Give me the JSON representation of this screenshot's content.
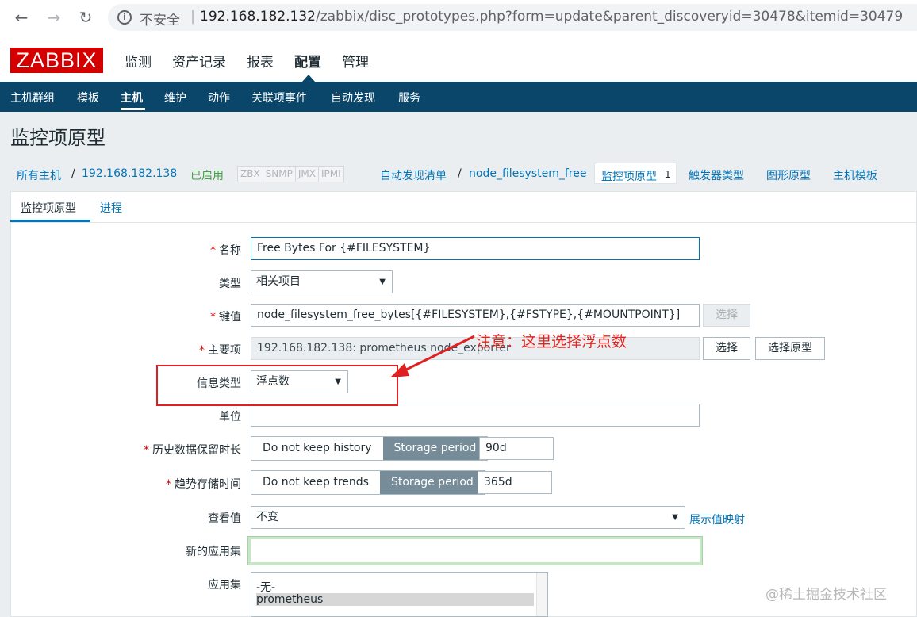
{
  "browser": {
    "insecure": "不安全",
    "url_host": "192.168.182.132",
    "url_path": "/zabbix/disc_prototypes.php?form=update&parent_discoveryid=30478&itemid=30479"
  },
  "logo": "ZABBIX",
  "top_menu": [
    "监测",
    "资产记录",
    "报表",
    "配置",
    "管理"
  ],
  "sub_menu": [
    "主机群组",
    "模板",
    "主机",
    "维护",
    "动作",
    "关联项事件",
    "自动发现",
    "服务"
  ],
  "page_title": "监控项原型",
  "breadcrumb": {
    "all_hosts": "所有主机",
    "host": "192.168.182.138",
    "status": "已启用",
    "availability": [
      "ZBX",
      "SNMP",
      "JMX",
      "IPMI"
    ],
    "discovery_list": "自动发现清单",
    "discovery_rule": "node_filesystem_free",
    "item_prototypes": "监控项原型",
    "item_prototypes_count": "1",
    "trigger_types": "触发器类型",
    "graph_prototypes": "图形原型",
    "host_templates": "主机模板"
  },
  "tabs": [
    "监控项原型",
    "进程"
  ],
  "form": {
    "name_label": "名称",
    "name_value": "Free Bytes For {#FILESYSTEM}",
    "type_label": "类型",
    "type_value": "相关项目",
    "key_label": "键值",
    "key_value": "node_filesystem_free_bytes[{#FILESYSTEM},{#FSTYPE},{#MOUNTPOINT}]",
    "key_select": "选择",
    "master_label": "主要项",
    "master_value": "192.168.182.138: prometheus node_exporter",
    "master_select": "选择",
    "master_select_proto": "选择原型",
    "info_type_label": "信息类型",
    "info_type_value": "浮点数",
    "units_label": "单位",
    "units_value": "",
    "history_label": "历史数据保留时长",
    "history_off": "Do not keep history",
    "history_on": "Storage period",
    "history_value": "90d",
    "trends_label": "趋势存储时间",
    "trends_off": "Do not keep trends",
    "trends_on": "Storage period",
    "trends_value": "365d",
    "valuemap_label": "查看值",
    "valuemap_value": "不变",
    "valuemap_link": "展示值映射",
    "new_app_label": "新的应用集",
    "new_app_value": "",
    "apps_label": "应用集",
    "apps_options": [
      "-无-",
      "prometheus"
    ]
  },
  "annotation": "注意：这里选择浮点数",
  "watermark": "@稀土掘金技术社区",
  "colors": {
    "brand_red": "#d40000",
    "nav_blue": "#0a466a",
    "link_blue": "#0275b8",
    "annotation_red": "#e02020"
  }
}
